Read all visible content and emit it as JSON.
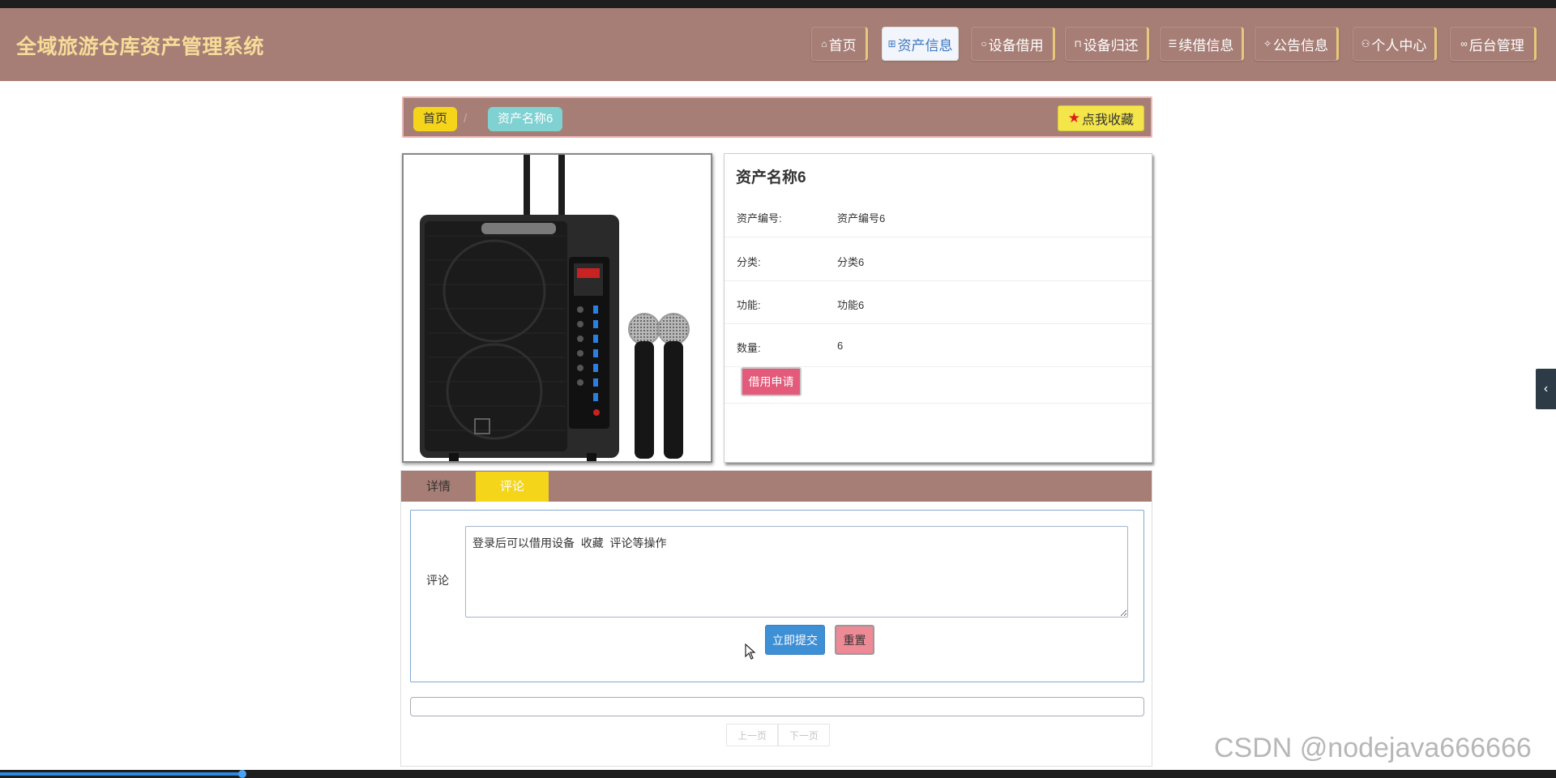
{
  "header": {
    "site_title": "全域旅游仓库资产管理系统",
    "nav": [
      {
        "label": "首页",
        "icon": "home-icon",
        "active": false
      },
      {
        "label": "资产信息",
        "icon": "grid-icon",
        "active": true
      },
      {
        "label": "设备借用",
        "icon": "chat-icon",
        "active": false
      },
      {
        "label": "设备归还",
        "icon": "return-icon",
        "active": false
      },
      {
        "label": "续借信息",
        "icon": "list-icon",
        "active": false
      },
      {
        "label": "公告信息",
        "icon": "notice-icon",
        "active": false
      },
      {
        "label": "个人中心",
        "icon": "user-icon",
        "active": false
      },
      {
        "label": "后台管理",
        "icon": "link-icon",
        "active": false
      }
    ]
  },
  "breadcrumb": {
    "home": "首页",
    "separator": "/",
    "current": "资产名称6",
    "favorite_label": "点我收藏"
  },
  "asset": {
    "title": "资产名称6",
    "image": "portable-speaker-with-microphones",
    "fields": [
      {
        "label": "资产编号:",
        "value": "资产编号6"
      },
      {
        "label": "分类:",
        "value": "分类6"
      },
      {
        "label": "功能:",
        "value": "功能6"
      },
      {
        "label": "数量:",
        "value": "6"
      }
    ],
    "borrow_label": "借用申请"
  },
  "tabs": {
    "details": "详情",
    "comments": "评论",
    "active": "comments"
  },
  "comment_form": {
    "label": "评论",
    "textarea_value": "登录后可以借用设备  收藏  评论等操作",
    "submit_label": "立即提交",
    "reset_label": "重置"
  },
  "pager": {
    "prev": "上一页",
    "next": "下一页"
  },
  "watermark": "CSDN @nodejava666666",
  "colors": {
    "header_bg": "#a67e76",
    "title_color": "#f6dc98",
    "crumb_home": "#f5d51a",
    "crumb_current": "#7fd1d2",
    "favorite_bg": "#f3e54a",
    "borrow_bg": "#e35a7a",
    "submit_bg": "#3d8fd6",
    "reset_bg": "#ee8a95"
  }
}
